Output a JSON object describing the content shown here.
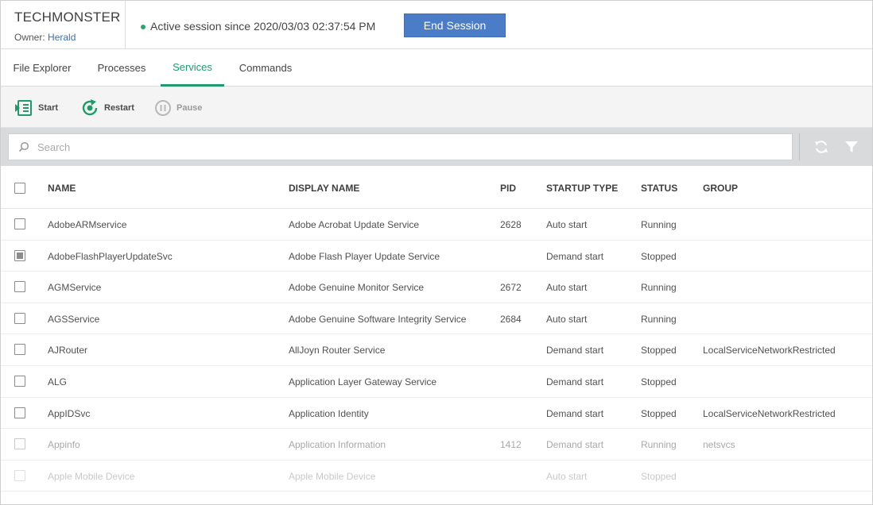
{
  "header": {
    "device_name": "TECHMONSTER",
    "owner_label": "Owner:",
    "owner_name": "Herald",
    "session_text": "Active session since 2020/03/03 02:37:54 PM",
    "end_session_label": "End Session"
  },
  "tabs": [
    {
      "label": "File Explorer",
      "active": false
    },
    {
      "label": "Processes",
      "active": false
    },
    {
      "label": "Services",
      "active": true
    },
    {
      "label": "Commands",
      "active": false
    }
  ],
  "toolbar": {
    "start_label": "Start",
    "restart_label": "Restart",
    "pause_label": "Pause"
  },
  "search": {
    "placeholder": "Search",
    "value": ""
  },
  "table": {
    "columns": [
      "NAME",
      "DISPLAY NAME",
      "PID",
      "STARTUP TYPE",
      "STATUS",
      "GROUP"
    ],
    "rows": [
      {
        "name": "AdobeARMservice",
        "display_name": "Adobe Acrobat Update Service",
        "pid": "2628",
        "startup_type": "Auto start",
        "status": "Running",
        "group": "",
        "checked": false
      },
      {
        "name": "AdobeFlashPlayerUpdateSvc",
        "display_name": "Adobe Flash Player Update Service",
        "pid": "",
        "startup_type": "Demand start",
        "status": "Stopped",
        "group": "",
        "checked": true
      },
      {
        "name": "AGMService",
        "display_name": "Adobe Genuine Monitor Service",
        "pid": "2672",
        "startup_type": "Auto start",
        "status": "Running",
        "group": "",
        "checked": false
      },
      {
        "name": "AGSService",
        "display_name": "Adobe Genuine Software Integrity Service",
        "pid": "2684",
        "startup_type": "Auto start",
        "status": "Running",
        "group": "",
        "checked": false
      },
      {
        "name": "AJRouter",
        "display_name": "AllJoyn Router Service",
        "pid": "",
        "startup_type": "Demand start",
        "status": "Stopped",
        "group": "LocalServiceNetworkRestricted",
        "checked": false
      },
      {
        "name": "ALG",
        "display_name": "Application Layer Gateway Service",
        "pid": "",
        "startup_type": "Demand start",
        "status": "Stopped",
        "group": "",
        "checked": false
      },
      {
        "name": "AppIDSvc",
        "display_name": "Application Identity",
        "pid": "",
        "startup_type": "Demand start",
        "status": "Stopped",
        "group": "LocalServiceNetworkRestricted",
        "checked": false
      },
      {
        "name": "Appinfo",
        "display_name": "Application Information",
        "pid": "1412",
        "startup_type": "Demand start",
        "status": "Running",
        "group": "netsvcs",
        "checked": false
      },
      {
        "name": "Apple Mobile Device",
        "display_name": "Apple Mobile Device",
        "pid": "",
        "startup_type": "Auto start",
        "status": "Stopped",
        "group": "",
        "checked": false
      }
    ]
  },
  "colors": {
    "accent_green": "#1f9b6b",
    "button_blue": "#4b7cc7",
    "link_blue": "#3b6fb6",
    "status_dot": "#2aa46e"
  },
  "icons": {
    "start": "start-icon",
    "restart": "restart-icon",
    "pause": "pause-icon",
    "search": "search-icon",
    "refresh": "refresh-icon",
    "filter": "filter-icon"
  }
}
